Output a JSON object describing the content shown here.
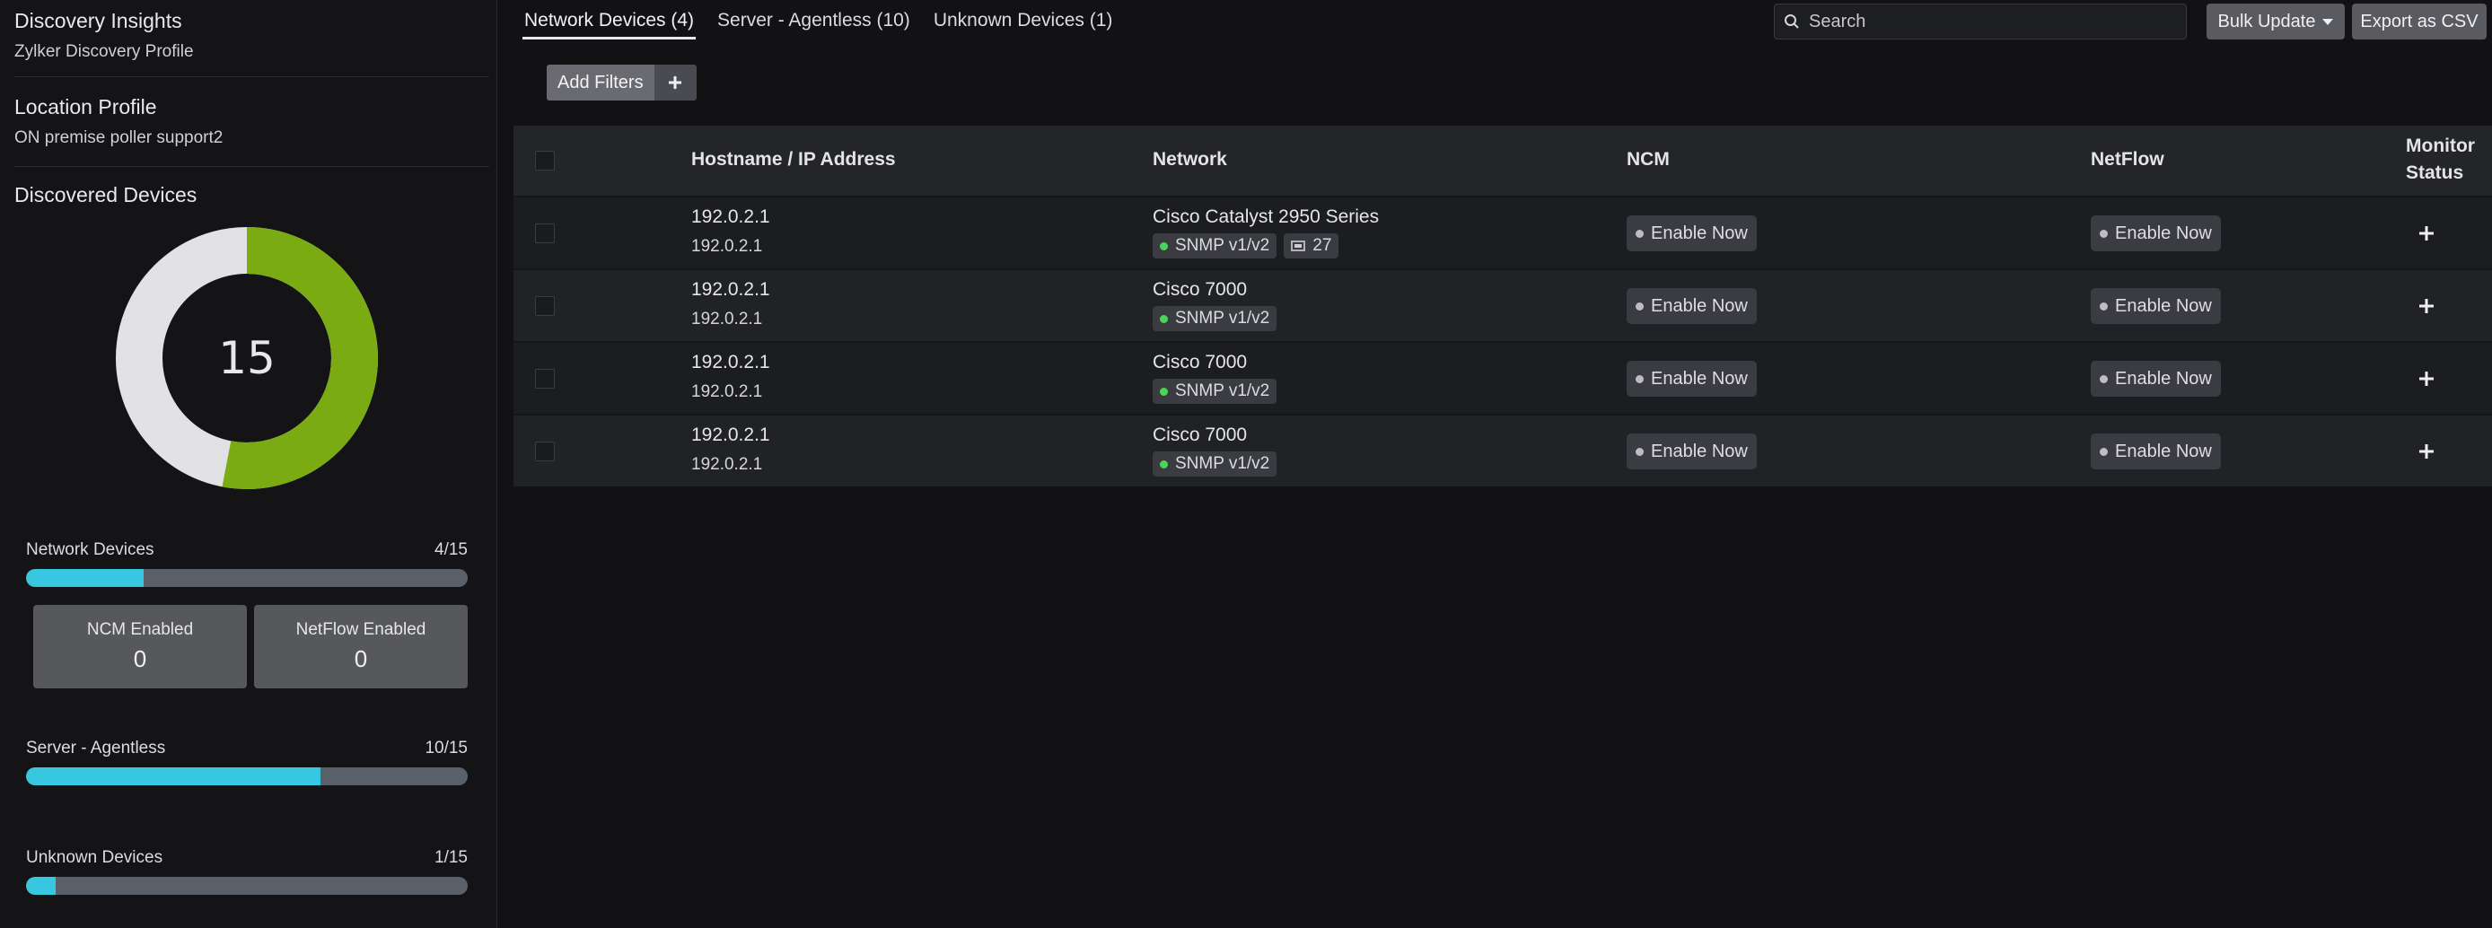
{
  "sidebar": {
    "insights_title": "Discovery Insights",
    "insights_profile": "Zylker Discovery Profile",
    "location_title": "Location Profile",
    "location_value": "ON premise poller support2",
    "discovered_title": "Discovered Devices",
    "donut_total": "15",
    "donut_fraction": 0.53,
    "stats": [
      {
        "label": "Network Devices",
        "count": "4/15",
        "fraction": 0.267
      },
      {
        "label": "Server - Agentless",
        "count": "10/15",
        "fraction": 0.667
      },
      {
        "label": "Unknown Devices",
        "count": "1/15",
        "fraction": 0.067
      }
    ],
    "ncm_label": "NCM Enabled",
    "ncm_value": "0",
    "netflow_label": "NetFlow Enabled",
    "netflow_value": "0"
  },
  "tabs": [
    {
      "label": "Network Devices (4)"
    },
    {
      "label": "Server - Agentless (10)"
    },
    {
      "label": "Unknown Devices (1)"
    }
  ],
  "search": {
    "placeholder": "Search"
  },
  "toolbar": {
    "bulk_label": "Bulk Update",
    "export_label": "Export as CSV",
    "add_filters_label": "Add Filters"
  },
  "table": {
    "headers": {
      "host": "Hostname / IP Address",
      "network": "Network",
      "ncm": "NCM",
      "netflow": "NetFlow",
      "monitor": "Monitor Status"
    },
    "rows": [
      {
        "ip": "192.0.2.1",
        "ip2": "192.0.2.1",
        "network": "Cisco Catalyst 2950 Series",
        "protocol": "SNMP v1/v2",
        "extra": "27",
        "ncm": "Enable Now",
        "netflow": "Enable Now"
      },
      {
        "ip": "192.0.2.1",
        "ip2": "192.0.2.1",
        "network": "Cisco 7000",
        "protocol": "SNMP v1/v2",
        "extra": "",
        "ncm": "Enable Now",
        "netflow": "Enable Now"
      },
      {
        "ip": "192.0.2.1",
        "ip2": "192.0.2.1",
        "network": "Cisco 7000",
        "protocol": "SNMP v1/v2",
        "extra": "",
        "ncm": "Enable Now",
        "netflow": "Enable Now"
      },
      {
        "ip": "192.0.2.1",
        "ip2": "192.0.2.1",
        "network": "Cisco 7000",
        "protocol": "SNMP v1/v2",
        "extra": "",
        "ncm": "Enable Now",
        "netflow": "Enable Now"
      }
    ]
  },
  "colors": {
    "accent_green": "#7aab13",
    "donut_grey": "#e2e2e4",
    "bar_fill": "#38c7e0",
    "status_green": "#4cd45a"
  }
}
